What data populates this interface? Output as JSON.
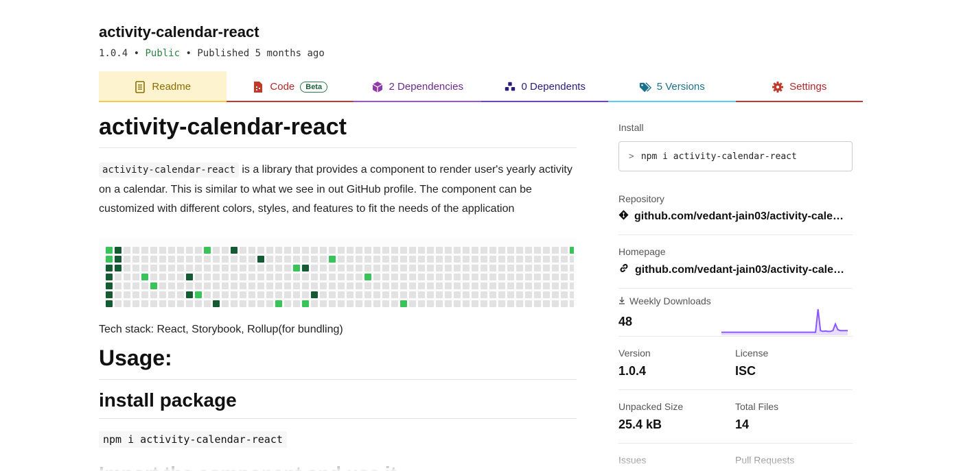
{
  "package": {
    "name": "activity-calendar-react",
    "version": "1.0.4",
    "sep": "•",
    "visibility": "Public",
    "published": "Published 5 months ago"
  },
  "tabs": [
    {
      "label": "Readme",
      "color": "#8a6d00",
      "underline": "#f2c94c",
      "icon": "readme-icon"
    },
    {
      "label": "Code",
      "badge": "Beta",
      "color": "#b3262a",
      "underline": "#c0392b",
      "icon": "code-file-icon"
    },
    {
      "label": "2 Dependencies",
      "color": "#6b2a8c",
      "underline": "#9b51e0",
      "icon": "box-icon"
    },
    {
      "label": "0 Dependents",
      "color": "#2d1a7a",
      "underline": "#6a3de8",
      "icon": "cubes-icon"
    },
    {
      "label": "5 Versions",
      "color": "#1b6f8a",
      "underline": "#56ccf2",
      "icon": "tags-icon"
    },
    {
      "label": "Settings",
      "color": "#b3262a",
      "underline": "#c0392b",
      "icon": "gear-icon"
    }
  ],
  "readme": {
    "title": "activity-calendar-react",
    "intro_code": "activity-calendar-react",
    "intro_text": " is a library that provides a component to render user's yearly activity on a calendar. This is similar to what we see in out GitHub profile. The component can be customized with different colors, styles, and features to fit the needs of the application",
    "tech_stack": "Tech stack: React, Storybook, Rollup(for bundling)",
    "usage_heading": "Usage:",
    "install_heading": "install package",
    "install_cmd": "npm i activity-calendar-react",
    "import_heading": "Import the component and use it"
  },
  "calendar": {
    "weeks": 53,
    "days": 7,
    "colors": {
      "empty": "#e2e2e2",
      "light": "#39c45a",
      "dark": "#145a32"
    },
    "active_cells": [
      {
        "week": 0,
        "day": 0,
        "level": "light"
      },
      {
        "week": 1,
        "day": 0,
        "level": "dark"
      },
      {
        "week": 0,
        "day": 1,
        "level": "light"
      },
      {
        "week": 1,
        "day": 1,
        "level": "dark"
      },
      {
        "week": 0,
        "day": 2,
        "level": "dark"
      },
      {
        "week": 0,
        "day": 3,
        "level": "dark"
      },
      {
        "week": 0,
        "day": 4,
        "level": "dark"
      },
      {
        "week": 0,
        "day": 5,
        "level": "dark"
      },
      {
        "week": 0,
        "day": 6,
        "level": "dark"
      },
      {
        "week": 1,
        "day": 2,
        "level": "dark"
      },
      {
        "week": 4,
        "day": 3,
        "level": "light"
      },
      {
        "week": 5,
        "day": 4,
        "level": "light"
      },
      {
        "week": 9,
        "day": 3,
        "level": "dark"
      },
      {
        "week": 9,
        "day": 5,
        "level": "dark"
      },
      {
        "week": 10,
        "day": 5,
        "level": "light"
      },
      {
        "week": 11,
        "day": 0,
        "level": "light"
      },
      {
        "week": 12,
        "day": 6,
        "level": "dark"
      },
      {
        "week": 14,
        "day": 0,
        "level": "dark"
      },
      {
        "week": 17,
        "day": 1,
        "level": "dark"
      },
      {
        "week": 19,
        "day": 6,
        "level": "light"
      },
      {
        "week": 21,
        "day": 2,
        "level": "light"
      },
      {
        "week": 22,
        "day": 2,
        "level": "dark"
      },
      {
        "week": 22,
        "day": 6,
        "level": "light"
      },
      {
        "week": 23,
        "day": 5,
        "level": "dark"
      },
      {
        "week": 25,
        "day": 1,
        "level": "light"
      },
      {
        "week": 29,
        "day": 3,
        "level": "light"
      },
      {
        "week": 33,
        "day": 6,
        "level": "light"
      },
      {
        "week": 52,
        "day": 0,
        "level": "light"
      }
    ]
  },
  "sidebar": {
    "install_label": "Install",
    "install_prompt": ">",
    "install_cmd": "npm i activity-calendar-react",
    "repository_label": "Repository",
    "repository_url": "github.com/vedant-jain03/activity-cale…",
    "homepage_label": "Homepage",
    "homepage_url": "github.com/vedant-jain03/activity-cale…",
    "downloads_label": "Weekly Downloads",
    "downloads_value": "48",
    "downloads_trend": [
      2,
      2,
      2,
      2,
      2,
      2,
      2,
      2,
      2,
      2,
      2,
      2,
      2,
      2,
      2,
      2,
      2,
      2,
      2,
      2,
      2,
      2,
      2,
      2,
      2,
      2,
      2,
      2,
      2,
      2,
      2,
      2,
      2,
      2,
      2,
      2,
      2,
      2,
      2,
      30,
      4,
      3,
      3.5,
      3,
      3,
      4,
      12,
      5,
      4,
      4,
      4,
      4
    ],
    "version_label": "Version",
    "version_value": "1.0.4",
    "license_label": "License",
    "license_value": "ISC",
    "unpacked_label": "Unpacked Size",
    "unpacked_value": "25.4 kB",
    "files_label": "Total Files",
    "files_value": "14",
    "issues_label": "Issues",
    "pulls_label": "Pull Requests"
  }
}
